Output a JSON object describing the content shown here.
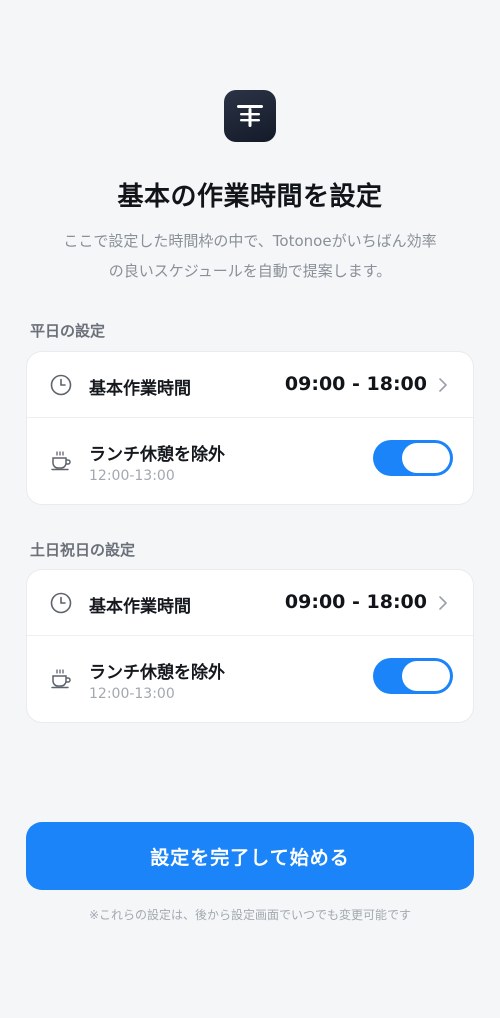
{
  "header": {
    "title": "基本の作業時間を設定",
    "subtitle_line1": "ここで設定した時間枠の中で、Totonoeがいちばん効率",
    "subtitle_line2": "の良いスケジュールを自動で提案します。"
  },
  "weekday": {
    "section_label": "平日の設定",
    "work_hours_label": "基本作業時間",
    "work_hours_value": "09:00 - 18:00",
    "lunch_label": "ランチ休憩を除外",
    "lunch_time": "12:00-13:00",
    "lunch_toggle_on": true
  },
  "holiday": {
    "section_label": "土日祝日の設定",
    "work_hours_label": "基本作業時間",
    "work_hours_value": "09:00 - 18:00",
    "lunch_label": "ランチ休憩を除外",
    "lunch_time": "12:00-13:00",
    "lunch_toggle_on": true
  },
  "cta": {
    "label": "設定を完了して始める"
  },
  "footnote": "※これらの設定は、後から設定画面でいつでも変更可能です",
  "colors": {
    "accent": "#1a84f8",
    "logo_bg": "#1c2333",
    "background": "#f5f6f8",
    "card": "#ffffff",
    "muted_text": "#8a8f98"
  },
  "icons": {
    "logo": "app-logo-icon",
    "work_hours": "clock-icon",
    "lunch": "coffee-cup-icon",
    "disclosure": "chevron-right-icon"
  }
}
